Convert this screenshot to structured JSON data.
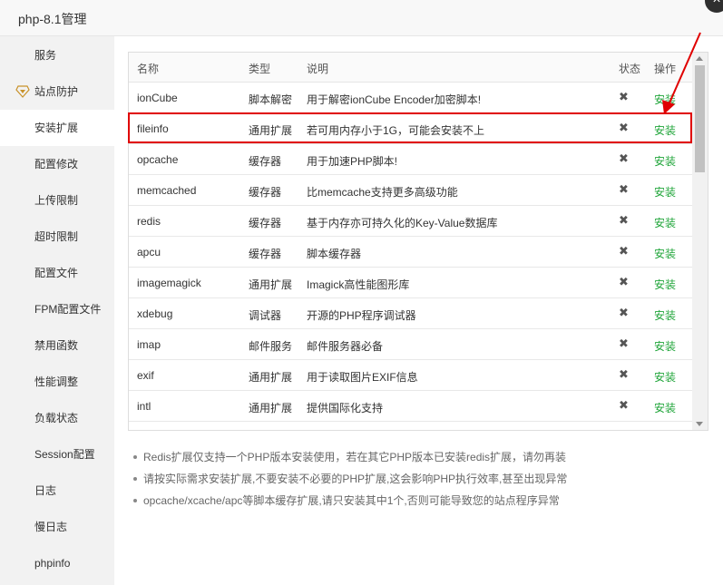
{
  "window": {
    "title": "php-8.1管理",
    "close_symbol": "×"
  },
  "sidebar": {
    "items": [
      {
        "label": "服务"
      },
      {
        "label": "站点防护",
        "icon": "shield-icon"
      },
      {
        "label": "安装扩展",
        "active": true
      },
      {
        "label": "配置修改"
      },
      {
        "label": "上传限制"
      },
      {
        "label": "超时限制"
      },
      {
        "label": "配置文件"
      },
      {
        "label": "FPM配置文件"
      },
      {
        "label": "禁用函数"
      },
      {
        "label": "性能调整"
      },
      {
        "label": "负载状态"
      },
      {
        "label": "Session配置"
      },
      {
        "label": "日志"
      },
      {
        "label": "慢日志"
      },
      {
        "label": "phpinfo"
      }
    ]
  },
  "table": {
    "headers": {
      "name": "名称",
      "type": "类型",
      "desc": "说明",
      "status": "状态",
      "action": "操作"
    },
    "rows": [
      {
        "name": "ionCube",
        "type": "脚本解密",
        "desc": "用于解密ionCube Encoder加密脚本!",
        "status": "✖",
        "action": "安装"
      },
      {
        "name": "fileinfo",
        "type": "通用扩展",
        "desc": "若可用内存小于1G，可能会安装不上",
        "status": "✖",
        "action": "安装"
      },
      {
        "name": "opcache",
        "type": "缓存器",
        "desc": "用于加速PHP脚本!",
        "status": "✖",
        "action": "安装"
      },
      {
        "name": "memcached",
        "type": "缓存器",
        "desc": "比memcache支持更多高级功能",
        "status": "✖",
        "action": "安装"
      },
      {
        "name": "redis",
        "type": "缓存器",
        "desc": "基于内存亦可持久化的Key-Value数据库",
        "status": "✖",
        "action": "安装"
      },
      {
        "name": "apcu",
        "type": "缓存器",
        "desc": "脚本缓存器",
        "status": "✖",
        "action": "安装"
      },
      {
        "name": "imagemagick",
        "type": "通用扩展",
        "desc": "Imagick高性能图形库",
        "status": "✖",
        "action": "安装"
      },
      {
        "name": "xdebug",
        "type": "调试器",
        "desc": "开源的PHP程序调试器",
        "status": "✖",
        "action": "安装"
      },
      {
        "name": "imap",
        "type": "邮件服务",
        "desc": "邮件服务器必备",
        "status": "✖",
        "action": "安装"
      },
      {
        "name": "exif",
        "type": "通用扩展",
        "desc": "用于读取图片EXIF信息",
        "status": "✖",
        "action": "安装"
      },
      {
        "name": "intl",
        "type": "通用扩展",
        "desc": "提供国际化支持",
        "status": "✖",
        "action": "安装"
      },
      {
        "name": "",
        "type": "",
        "desc": "",
        "status": "",
        "action": ""
      }
    ]
  },
  "notes": [
    "Redis扩展仅支持一个PHP版本安装使用，若在其它PHP版本已安装redis扩展，请勿再装",
    "请按实际需求安装扩展,不要安装不必要的PHP扩展,这会影响PHP执行效率,甚至出现异常",
    "opcache/xcache/apc等脚本缓存扩展,请只安装其中1个,否则可能导致您的站点程序异常"
  ],
  "colors": {
    "install_green": "#20a53a",
    "highlight_red": "#e00000",
    "sidebar_bg": "#f2f2f2"
  }
}
